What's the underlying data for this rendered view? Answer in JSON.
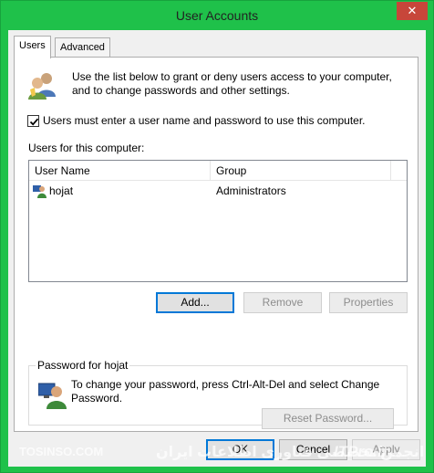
{
  "window": {
    "title": "User Accounts",
    "close_symbol": "✕"
  },
  "tabs": [
    {
      "label": "Users",
      "active": true
    },
    {
      "label": "Advanced",
      "active": false
    }
  ],
  "users_tab": {
    "intro_text": "Use the list below to grant or deny users access to your computer, and to change passwords and other settings.",
    "require_login": {
      "label": "Users must enter a user name and password to use this computer.",
      "checked": true
    },
    "users_label": "Users for this computer:",
    "list": {
      "columns": [
        "User Name",
        "Group"
      ],
      "rows": [
        {
          "user_name": "hojat",
          "group": "Administrators"
        }
      ]
    },
    "buttons": {
      "add": "Add...",
      "remove": "Remove",
      "properties": "Properties"
    },
    "password_group": {
      "legend": "Password for hojat",
      "text": "To change your password, press Ctrl-Alt-Del and select Change Password.",
      "reset_button": "Reset Password..."
    }
  },
  "footer_buttons": {
    "ok": "OK",
    "cancel": "Cancel",
    "apply": "Apply"
  },
  "watermark": {
    "left": "TOSINSO.COM",
    "center": "انجمن تخصصی فناوری اطلاعات ایران",
    "right": "ITPro.ir"
  },
  "icons": [
    "users-icon",
    "user-icon",
    "user-monitor-icon",
    "close-icon",
    "checkmark-icon"
  ],
  "colors": {
    "frame": "#1fc14a",
    "close_button": "#c7463a",
    "default_button_border": "#0078d7"
  }
}
